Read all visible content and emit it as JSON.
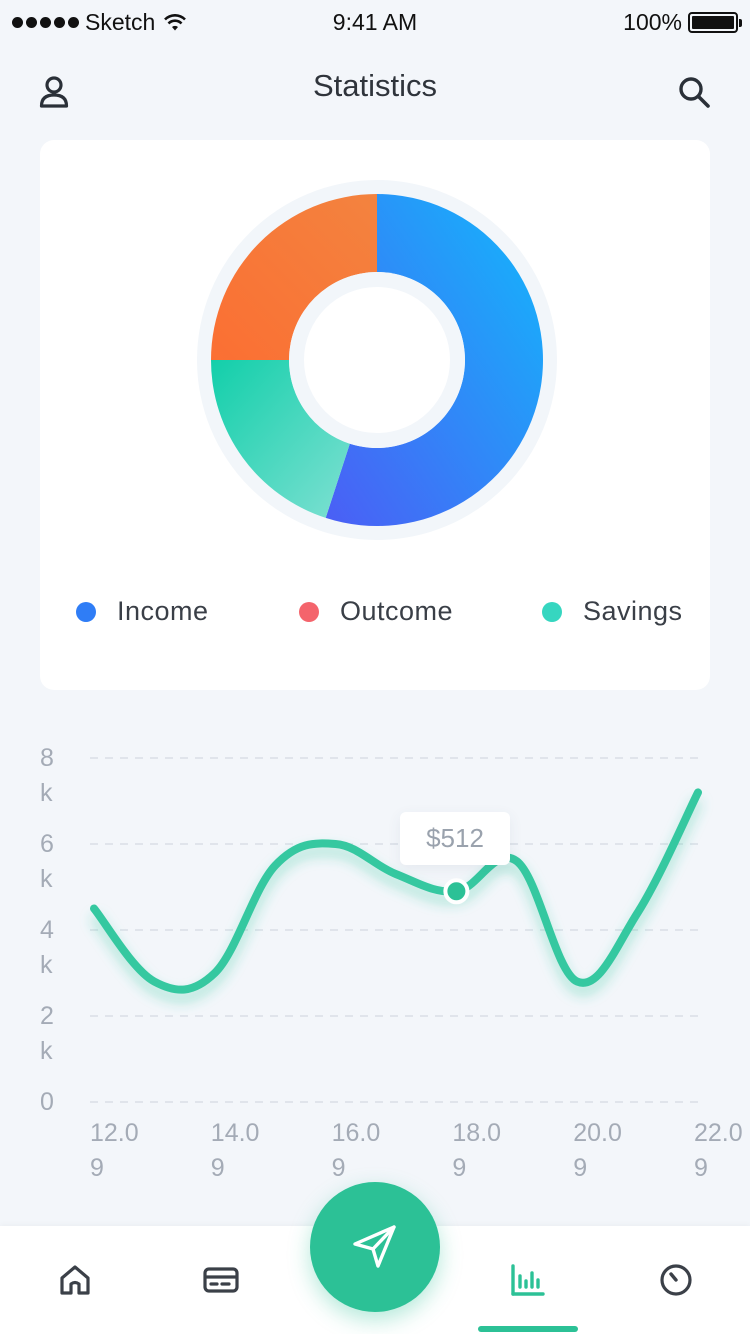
{
  "status_bar": {
    "carrier": "Sketch",
    "time": "9:41 AM",
    "battery": "100%",
    "battery_level": 1.0
  },
  "header": {
    "title": "Statistics",
    "profile_icon": "user-icon",
    "search_icon": "search-icon"
  },
  "summary_card": {
    "chart_data": {
      "type": "pie",
      "labels": [
        "Income",
        "Outcome",
        "Savings"
      ],
      "values": [
        55,
        25,
        20
      ],
      "colors": [
        "#2f7df6",
        "#f4725a",
        "#36d6c0"
      ],
      "legend": "bottom"
    },
    "legend": [
      {
        "label": "Income",
        "color": "#2f7df6"
      },
      {
        "label": "Outcome",
        "color": "#f4646c"
      },
      {
        "label": "Savings",
        "color": "#36d6c0"
      }
    ]
  },
  "trend_chart": {
    "chart_data": {
      "type": "line",
      "x": [
        "12.09",
        "13.09",
        "14.09",
        "15.09",
        "16.09",
        "17.09",
        "18.09",
        "19.09",
        "20.09",
        "21.09",
        "22.09"
      ],
      "y_ticks": [
        "8k",
        "6k",
        "4k",
        "2k",
        "0"
      ],
      "x_ticks": [
        "12.09",
        "14.09",
        "16.09",
        "18.09",
        "20.09",
        "22.09"
      ],
      "ylim": [
        0,
        8000
      ],
      "grid": true,
      "series": [
        {
          "values": [
            4500,
            2800,
            3000,
            5500,
            6000,
            5300,
            4900,
            5600,
            2800,
            4400,
            7200
          ],
          "color": "#36c9a0"
        }
      ],
      "highlight": {
        "x": "18.09",
        "value": 4900,
        "label": "$512"
      }
    }
  },
  "tab_bar": {
    "active_tab": "statistics",
    "accent_color": "#2cc196",
    "icons": [
      "home-icon",
      "card-icon",
      "send-icon",
      "bar-chart-icon",
      "gauge-icon"
    ]
  }
}
